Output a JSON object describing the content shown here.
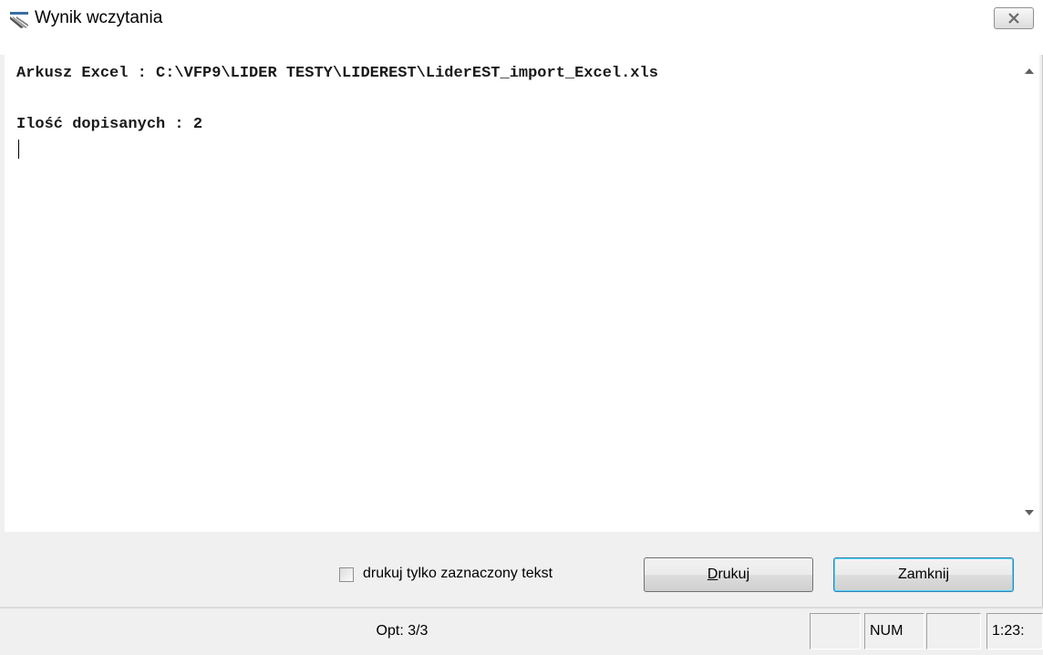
{
  "window": {
    "title": "Wynik wczytania",
    "title_icon": "app-icon",
    "close_icon": "close-icon"
  },
  "content": {
    "line1": "Arkusz Excel : C:\\VFP9\\LIDER TESTY\\LIDEREST\\LiderEST_import_Excel.xls",
    "line2": "",
    "line3": "Ilość dopisanych : 2"
  },
  "controls": {
    "checkbox_label": "drukuj tylko zaznaczony tekst",
    "checkbox_checked": false,
    "print_button_mnemonic": "D",
    "print_button_rest": "rukuj",
    "close_button": "Zamknij"
  },
  "statusbar": {
    "main": "Opt: 3/3",
    "cells": [
      "",
      "NUM",
      "",
      "1:23:"
    ]
  }
}
